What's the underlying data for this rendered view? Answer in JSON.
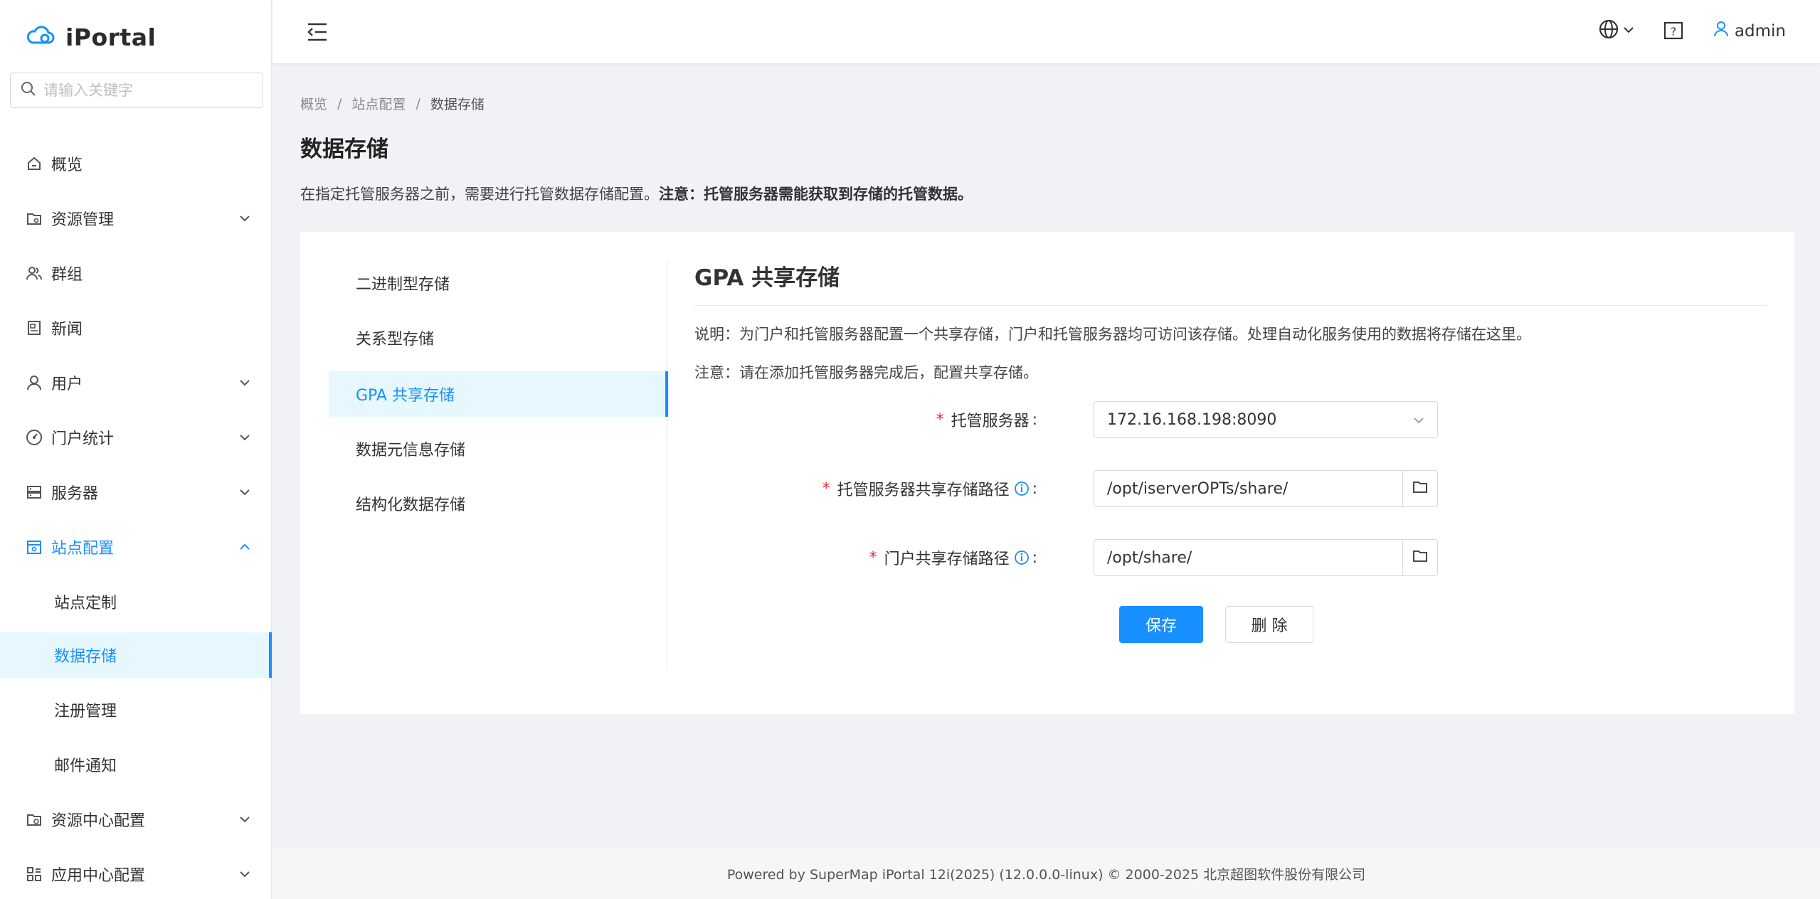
{
  "brand": {
    "name": "iPortal"
  },
  "search": {
    "placeholder": "请输入关键字"
  },
  "sidebar": {
    "items": [
      {
        "label": "概览"
      },
      {
        "label": "资源管理"
      },
      {
        "label": "群组"
      },
      {
        "label": "新闻"
      },
      {
        "label": "用户"
      },
      {
        "label": "门户统计"
      },
      {
        "label": "服务器"
      },
      {
        "label": "站点配置"
      },
      {
        "label": "资源中心配置"
      },
      {
        "label": "应用中心配置"
      }
    ],
    "site_config_children": [
      {
        "label": "站点定制"
      },
      {
        "label": "数据存储"
      },
      {
        "label": "注册管理"
      },
      {
        "label": "邮件通知"
      }
    ]
  },
  "header": {
    "username": "admin"
  },
  "breadcrumb": {
    "items": [
      "概览",
      "站点配置",
      "数据存储"
    ],
    "separator": "/"
  },
  "page": {
    "title": "数据存储",
    "description": "在指定托管服务器之前，需要进行托管数据存储配置。",
    "description_bold": "注意：托管服务器需能获取到存储的托管数据。"
  },
  "tabs": [
    {
      "label": "二进制型存储"
    },
    {
      "label": "关系型存储"
    },
    {
      "label": "GPA 共享存储"
    },
    {
      "label": "数据元信息存储"
    },
    {
      "label": "结构化数据存储"
    }
  ],
  "panel": {
    "title": "GPA 共享存储",
    "note1": "说明：为门户和托管服务器配置一个共享存储，门户和托管服务器均可访问该存储。处理自动化服务使用的数据将存储在这里。",
    "note2": "注意：请在添加托管服务器完成后，配置共享存储。",
    "form": {
      "required_mark": "*",
      "colon": ":",
      "hosted_server_label": "托管服务器",
      "hosted_server_value": "172.16.168.198:8090",
      "hosted_path_label": "托管服务器共享存储路径",
      "hosted_path_value": "/opt/iserverOPTs/share/",
      "portal_path_label": "门户共享存储路径",
      "portal_path_value": "/opt/share/"
    },
    "save_label": "保存",
    "delete_label": "删 除"
  },
  "footer": {
    "text": "Powered by SuperMap iPortal 12i(2025) (12.0.0.0-linux) © 2000-2025 北京超图软件股份有限公司"
  },
  "colors": {
    "primary": "#1890ff",
    "required": "#f5222d",
    "selected_bg": "#e6f7ff"
  }
}
